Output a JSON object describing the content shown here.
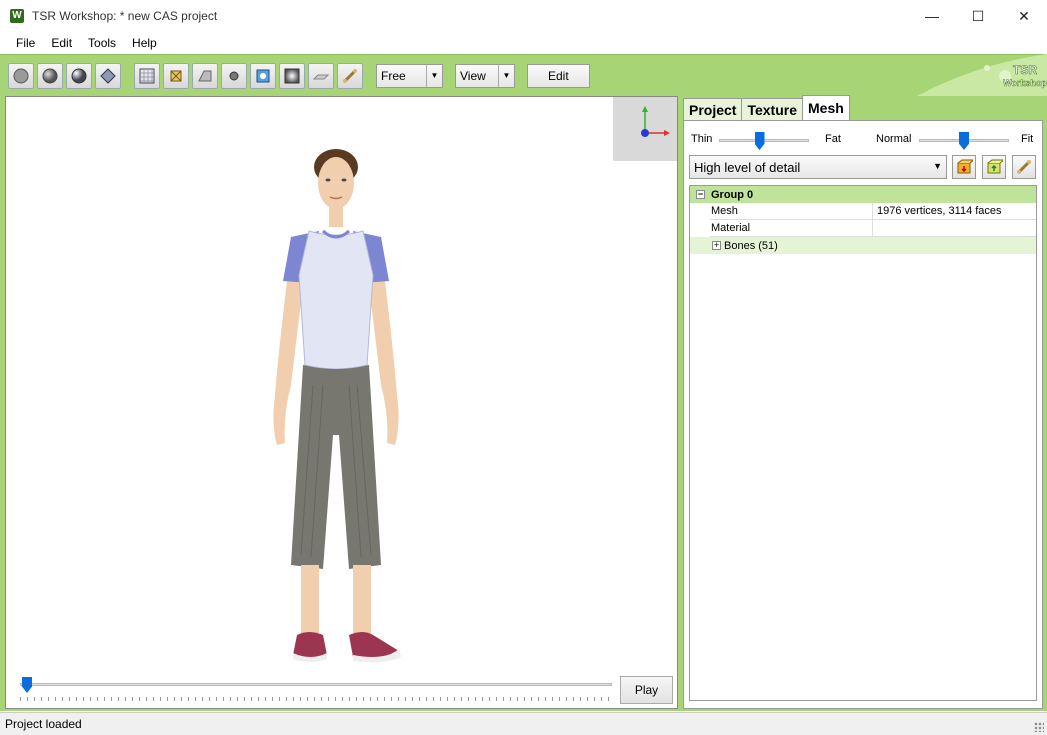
{
  "window": {
    "title": "TSR Workshop: * new CAS project",
    "app_icon_letter": "W",
    "minimize_glyph": "—",
    "maximize_glyph": "☐",
    "close_glyph": "✕"
  },
  "menu": [
    "File",
    "Edit",
    "Tools",
    "Help"
  ],
  "toolbar": {
    "camera_mode": "Free",
    "view_label": "View",
    "edit_label": "Edit",
    "logo_text_1": "TSR",
    "logo_text_2": "Workshop"
  },
  "viewport": {
    "play_label": "Play",
    "timeline_position": 0
  },
  "panel": {
    "tabs": [
      "Project",
      "Texture",
      "Mesh"
    ],
    "active_tab": "Mesh",
    "weight_slider": {
      "left_label": "Thin",
      "right_label": "Fat",
      "value": 0.45
    },
    "fitness_slider": {
      "left_label": "Normal",
      "right_label": "Fit",
      "value": 0.5
    },
    "lod_selected": "High level of detail",
    "tree": {
      "group_label": "Group 0",
      "rows": [
        {
          "name": "Mesh",
          "value": "1976 vertices, 3114 faces"
        },
        {
          "name": "Material",
          "value": ""
        }
      ],
      "bones_label": "Bones (51)"
    }
  },
  "status": {
    "text": "Project loaded"
  },
  "colors": {
    "frame_green": "#a7d575",
    "accent_blue": "#0a6ddc",
    "group_green": "#bfe39a"
  }
}
